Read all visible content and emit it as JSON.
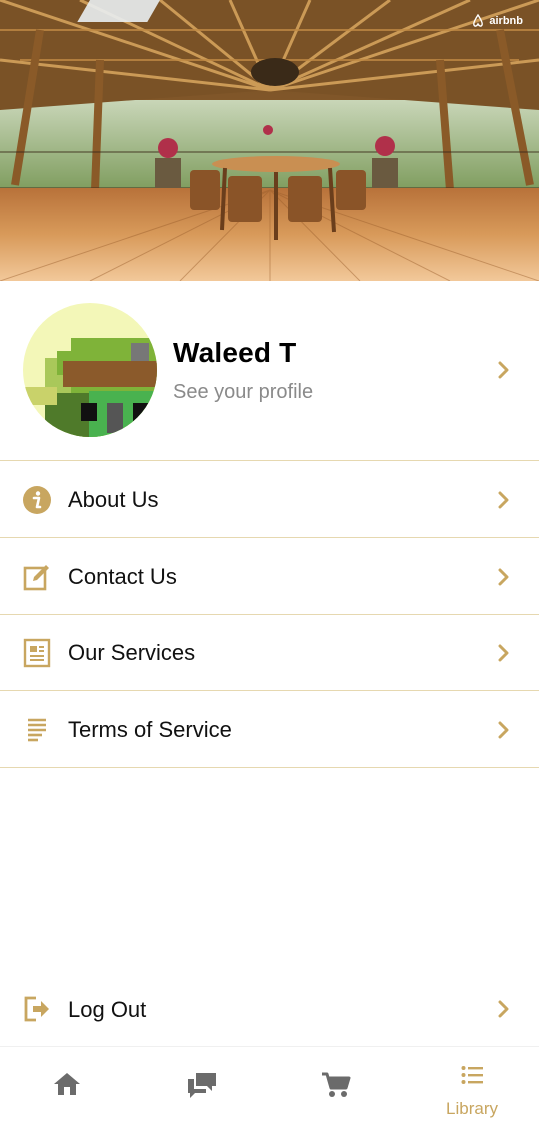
{
  "brand": {
    "name": "airbnb"
  },
  "profile": {
    "name": "Waleed T",
    "subtitle": "See your profile"
  },
  "menu": {
    "items": [
      {
        "label": "About Us",
        "icon": "info-icon"
      },
      {
        "label": "Contact Us",
        "icon": "edit-icon"
      },
      {
        "label": "Our Services",
        "icon": "document-icon"
      },
      {
        "label": "Terms of Service",
        "icon": "text-lines-icon"
      }
    ],
    "logout": {
      "label": "Log Out",
      "icon": "logout-icon"
    }
  },
  "bottom_nav": {
    "items": [
      {
        "icon": "home-icon",
        "label": ""
      },
      {
        "icon": "chat-icon",
        "label": ""
      },
      {
        "icon": "cart-icon",
        "label": ""
      },
      {
        "icon": "list-icon",
        "label": "Library",
        "active": true
      }
    ]
  },
  "colors": {
    "accent": "#c8a660",
    "divider": "#e6d8b0",
    "icon_gray": "#6b6b6b"
  }
}
